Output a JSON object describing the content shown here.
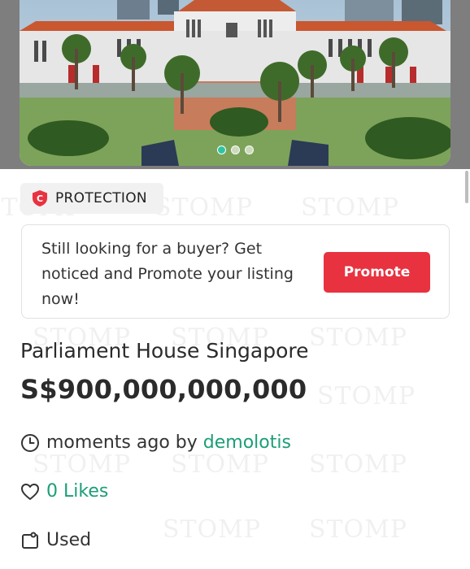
{
  "gallery": {
    "image_alt": "Parliament House Singapore",
    "slide_count": 3,
    "active_slide": 1
  },
  "watermark": {
    "text": "STOMP"
  },
  "protection": {
    "label": "PROTECTION",
    "icon": "shield-c-icon",
    "color": "#e8323f"
  },
  "promote": {
    "message": "Still looking for a buyer? Get noticed and Promote your listing now!",
    "button_label": "Promote",
    "button_color": "#e8323f"
  },
  "listing": {
    "title": "Parliament House Singapore",
    "price": "S$900,000,000,000",
    "time": "moments ago by ",
    "seller": "demolotis",
    "likes": "0 Likes",
    "condition": "Used"
  },
  "colors": {
    "accent": "#1b9e77",
    "primary_red": "#e8323f"
  }
}
